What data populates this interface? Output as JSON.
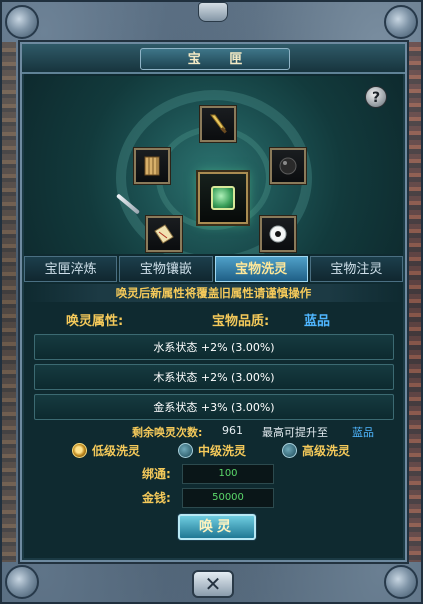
{
  "window": {
    "title": "宝 匣",
    "help_glyph": "?",
    "close_glyph": "✕"
  },
  "tabs": [
    {
      "label": "宝匣淬炼",
      "active": false
    },
    {
      "label": "宝物镶嵌",
      "active": false
    },
    {
      "label": "宝物洗灵",
      "active": true
    },
    {
      "label": "宝物注灵",
      "active": false
    }
  ],
  "notice": "唤灵后新属性将覆盖旧属性请谨慎操作",
  "attributes": {
    "label": "唤灵属性:",
    "quality_label": "宝物品质:",
    "quality_value": "蓝品"
  },
  "stats": [
    "水系状态 +2% (3.00%)",
    "木系状态 +2% (3.00%)",
    "金系状态 +3% (3.00%)"
  ],
  "remaining": {
    "label": "剩余唤灵次数:",
    "value": "961",
    "max_label": "最高可提升至",
    "max_value": "蓝品"
  },
  "levels": [
    {
      "label": "低级洗灵",
      "selected": true
    },
    {
      "label": "中级洗灵",
      "selected": false
    },
    {
      "label": "高级洗灵",
      "selected": false
    }
  ],
  "costs": {
    "bind_label": "绑通:",
    "bind_value": "100",
    "gold_label": "金钱:",
    "gold_value": "50000"
  },
  "action_button": "唤灵",
  "slots": [
    {
      "icon": "golden-dagger-icon"
    },
    {
      "icon": "bamboo-scroll-icon"
    },
    {
      "icon": "dark-orb-icon"
    },
    {
      "icon": "paper-talisman-icon"
    },
    {
      "icon": "white-jade-ring-icon"
    },
    {
      "icon": "green-jade-box-icon"
    }
  ],
  "colors": {
    "accent_gold": "#f4c95a",
    "quality_blue": "#4fb6ff",
    "value_green": "#5bd86a"
  }
}
